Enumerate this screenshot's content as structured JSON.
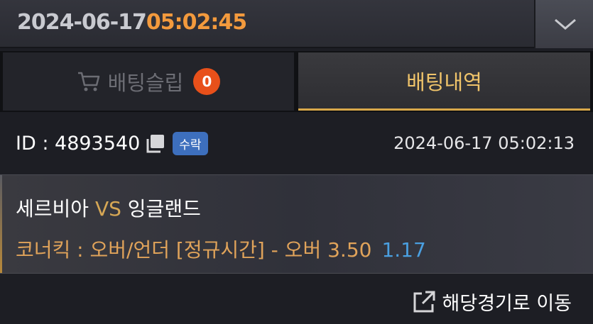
{
  "header": {
    "date": "2024-06-17",
    "time": "05:02:45"
  },
  "tabs": {
    "slip_label": "배팅슬립",
    "slip_count": "0",
    "history_label": "배팅내역"
  },
  "bet": {
    "id_label": "ID : 4893540",
    "status": "수락",
    "datetime": "2024-06-17 05:02:13"
  },
  "match": {
    "home": "세르비아",
    "vs": "VS",
    "away": "잉글랜드",
    "market": "코너킥 : 오버/언더 [정규시간] - 오버 3.50",
    "odds": "1.17"
  },
  "footer": {
    "goto_label": "해당경기로 이동"
  },
  "colors": {
    "accent_orange": "#f39a3d",
    "gold": "#f0c46a",
    "badge_red": "#e8501a",
    "status_blue": "#3d6fbd",
    "odds_blue": "#4a9fe0"
  }
}
